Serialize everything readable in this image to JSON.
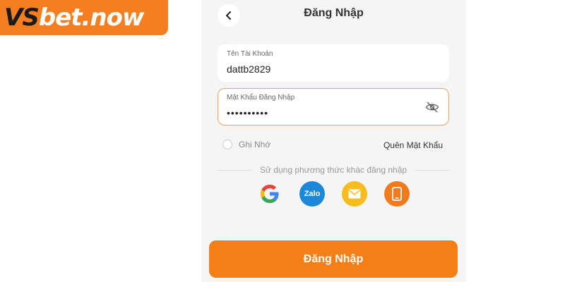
{
  "brand": {
    "logo_vs": "VS",
    "logo_rest": "bet.now"
  },
  "header": {
    "title": "Đăng Nhập"
  },
  "form": {
    "username": {
      "label": "Tên Tài Khoản",
      "value": "dattb2829"
    },
    "password": {
      "label": "Mật Khẩu Đăng Nhập",
      "value": "••••••••••"
    },
    "remember_label": "Ghi Nhớ",
    "forgot_label": "Quên Mật Khẩu",
    "alt_login_text": "Sử dụng phương thức khác đăng nhập",
    "zalo_label": "Zalo",
    "submit_label": "Đăng Nhập"
  },
  "colors": {
    "brand_orange": "#f57f20",
    "button_orange": "#f57f17",
    "zalo_blue": "#1e88d8",
    "mail_yellow": "#f7bd1e",
    "phone_orange": "#f07a1c",
    "focus_border": "#f6a25e"
  },
  "icons": {
    "back": "chevron-left-icon",
    "password_toggle": "eye-off-icon",
    "social": [
      "google-icon",
      "zalo-icon",
      "mail-icon",
      "phone-icon"
    ]
  }
}
